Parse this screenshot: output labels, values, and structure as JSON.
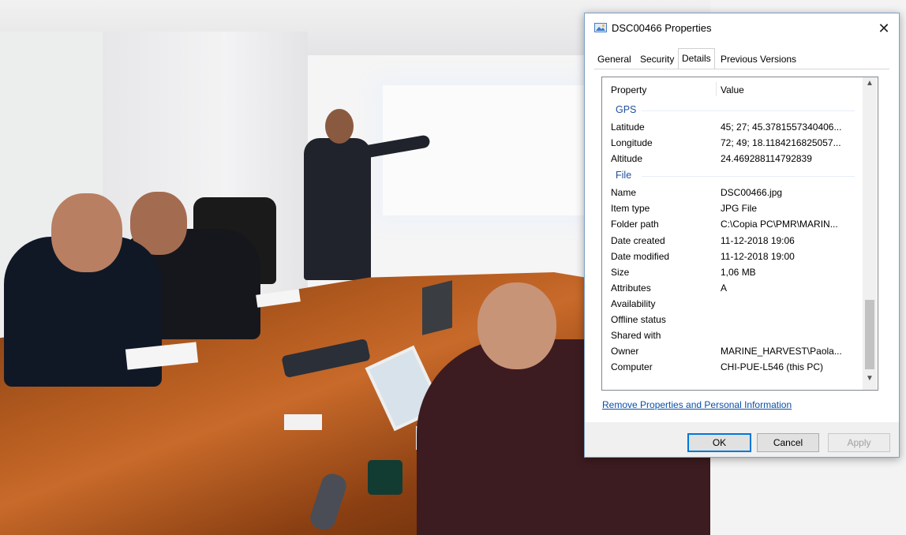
{
  "dialog": {
    "title": "DSC00466 Properties",
    "close_glyph": "✕",
    "tabs": [
      {
        "label": "General"
      },
      {
        "label": "Security"
      },
      {
        "label": "Details"
      },
      {
        "label": "Previous Versions"
      }
    ],
    "active_tab": "Details",
    "columns": {
      "property": "Property",
      "value": "Value"
    },
    "sections": {
      "gps": {
        "title": "GPS",
        "rows": [
          {
            "property": "Latitude",
            "value": "45; 27; 45.3781557340406..."
          },
          {
            "property": "Longitude",
            "value": "72; 49; 18.1184216825057..."
          },
          {
            "property": "Altitude",
            "value": "24.469288114792839"
          }
        ]
      },
      "file": {
        "title": "File",
        "rows": [
          {
            "property": "Name",
            "value": "DSC00466.jpg"
          },
          {
            "property": "Item type",
            "value": "JPG File"
          },
          {
            "property": "Folder path",
            "value": "C:\\Copia PC\\PMR\\MARIN..."
          },
          {
            "property": "Date created",
            "value": "11-12-2018 19:06"
          },
          {
            "property": "Date modified",
            "value": "11-12-2018 19:00"
          },
          {
            "property": "Size",
            "value": "1,06 MB"
          },
          {
            "property": "Attributes",
            "value": "A"
          },
          {
            "property": "Availability",
            "value": ""
          },
          {
            "property": "Offline status",
            "value": ""
          },
          {
            "property": "Shared with",
            "value": ""
          },
          {
            "property": "Owner",
            "value": "MARINE_HARVEST\\Paola..."
          },
          {
            "property": "Computer",
            "value": "CHI-PUE-L546 (this PC)"
          }
        ]
      }
    },
    "remove_link": "Remove Properties and Personal Information",
    "buttons": {
      "ok": "OK",
      "cancel": "Cancel",
      "apply": "Apply"
    },
    "scroll_up_glyph": "▲",
    "scroll_down_glyph": "▼"
  },
  "colors": {
    "accent": "#0078d7",
    "section_title": "#1e4f9c",
    "link": "#0a4fa8"
  }
}
